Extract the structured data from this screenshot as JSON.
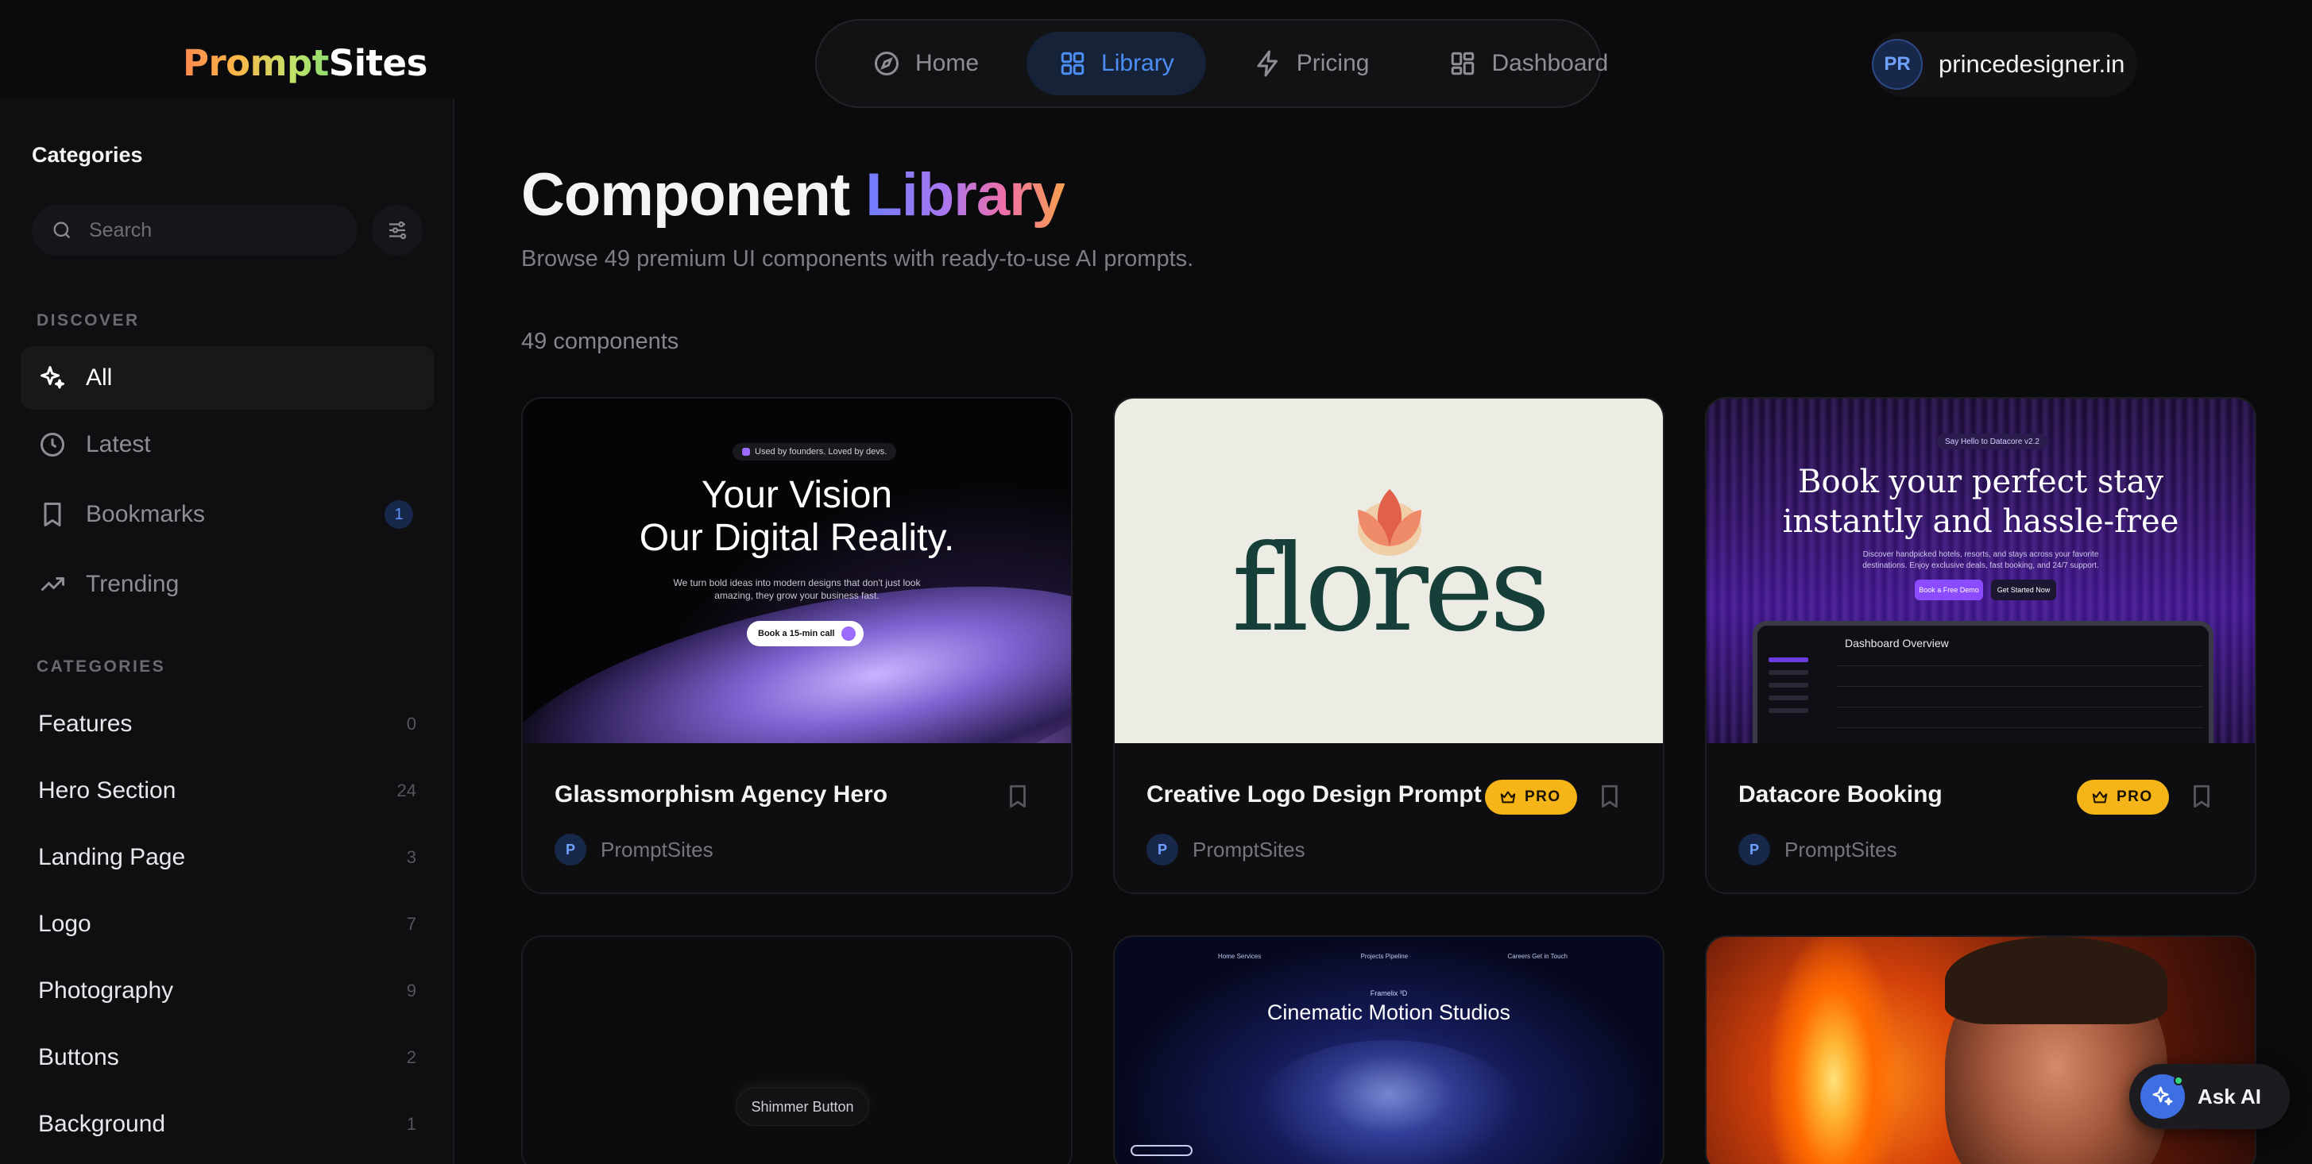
{
  "header": {
    "logo_part1": "Prompt",
    "logo_part2": "Sites",
    "nav": [
      {
        "label": "Home",
        "icon": "compass-icon",
        "active": false
      },
      {
        "label": "Library",
        "icon": "grid-icon",
        "active": true
      },
      {
        "label": "Pricing",
        "icon": "bolt-icon",
        "active": false
      },
      {
        "label": "Dashboard",
        "icon": "dashboard-icon",
        "active": false
      }
    ],
    "user": {
      "initials": "PR",
      "name": "princedesigner.in"
    }
  },
  "sidebar": {
    "title": "Categories",
    "search_placeholder": "Search",
    "discover_label": "DISCOVER",
    "discover": [
      {
        "label": "All",
        "icon": "sparkles-icon",
        "active": true
      },
      {
        "label": "Latest",
        "icon": "clock-icon"
      },
      {
        "label": "Bookmarks",
        "icon": "bookmark-icon",
        "badge": "1"
      },
      {
        "label": "Trending",
        "icon": "trending-up-icon"
      }
    ],
    "categories_label": "CATEGORIES",
    "categories": [
      {
        "label": "Features",
        "count": "0"
      },
      {
        "label": "Hero Section",
        "count": "24"
      },
      {
        "label": "Landing Page",
        "count": "3"
      },
      {
        "label": "Logo",
        "count": "7"
      },
      {
        "label": "Photography",
        "count": "9"
      },
      {
        "label": "Buttons",
        "count": "2"
      },
      {
        "label": "Background",
        "count": "1"
      }
    ]
  },
  "main": {
    "title_part1": "Component",
    "title_part2": "Library",
    "subtitle": "Browse 49 premium UI components with ready-to-use AI prompts.",
    "count_label": "49 components",
    "cards": [
      {
        "title": "Glassmorphism Agency Hero",
        "pro": false,
        "author_initial": "P",
        "author": "PromptSites",
        "thumb": {
          "pill": "Used by founders. Loved by devs.",
          "headline1": "Your Vision",
          "headline2": "Our Digital Reality.",
          "para": "We turn bold ideas into modern designs that don't just look amazing, they grow your business fast.",
          "cta": "Book a 15-min call"
        }
      },
      {
        "title": "Creative Logo Design Prompt",
        "pro": true,
        "pro_label": "PRO",
        "author_initial": "P",
        "author": "PromptSites",
        "thumb": {
          "word": "flores"
        }
      },
      {
        "title": "Datacore Booking",
        "pro": true,
        "pro_label": "PRO",
        "author_initial": "P",
        "author": "PromptSites",
        "thumb": {
          "pill": "Say Hello to Datacore v2.2",
          "headline1": "Book your perfect stay",
          "headline2": "instantly and hassle-free",
          "para": "Discover handpicked hotels, resorts, and stays across your favorite destinations. Enjoy exclusive deals, fast booking, and 24/7 support.",
          "btn1": "Book a Free Demo",
          "btn2": "Get Started Now",
          "dash_title": "Dashboard Overview"
        }
      },
      {
        "thumb": {
          "button": "Shimmer Button"
        }
      },
      {
        "thumb": {
          "small": "Framelix ³D",
          "headline": "Cinematic Motion Studios",
          "nav": [
            "Home\nServices",
            "Projects\nPipeline",
            "Careers\nGet in Touch"
          ]
        }
      },
      {
        "thumb": {}
      }
    ]
  },
  "ask_ai": {
    "label": "Ask AI"
  }
}
